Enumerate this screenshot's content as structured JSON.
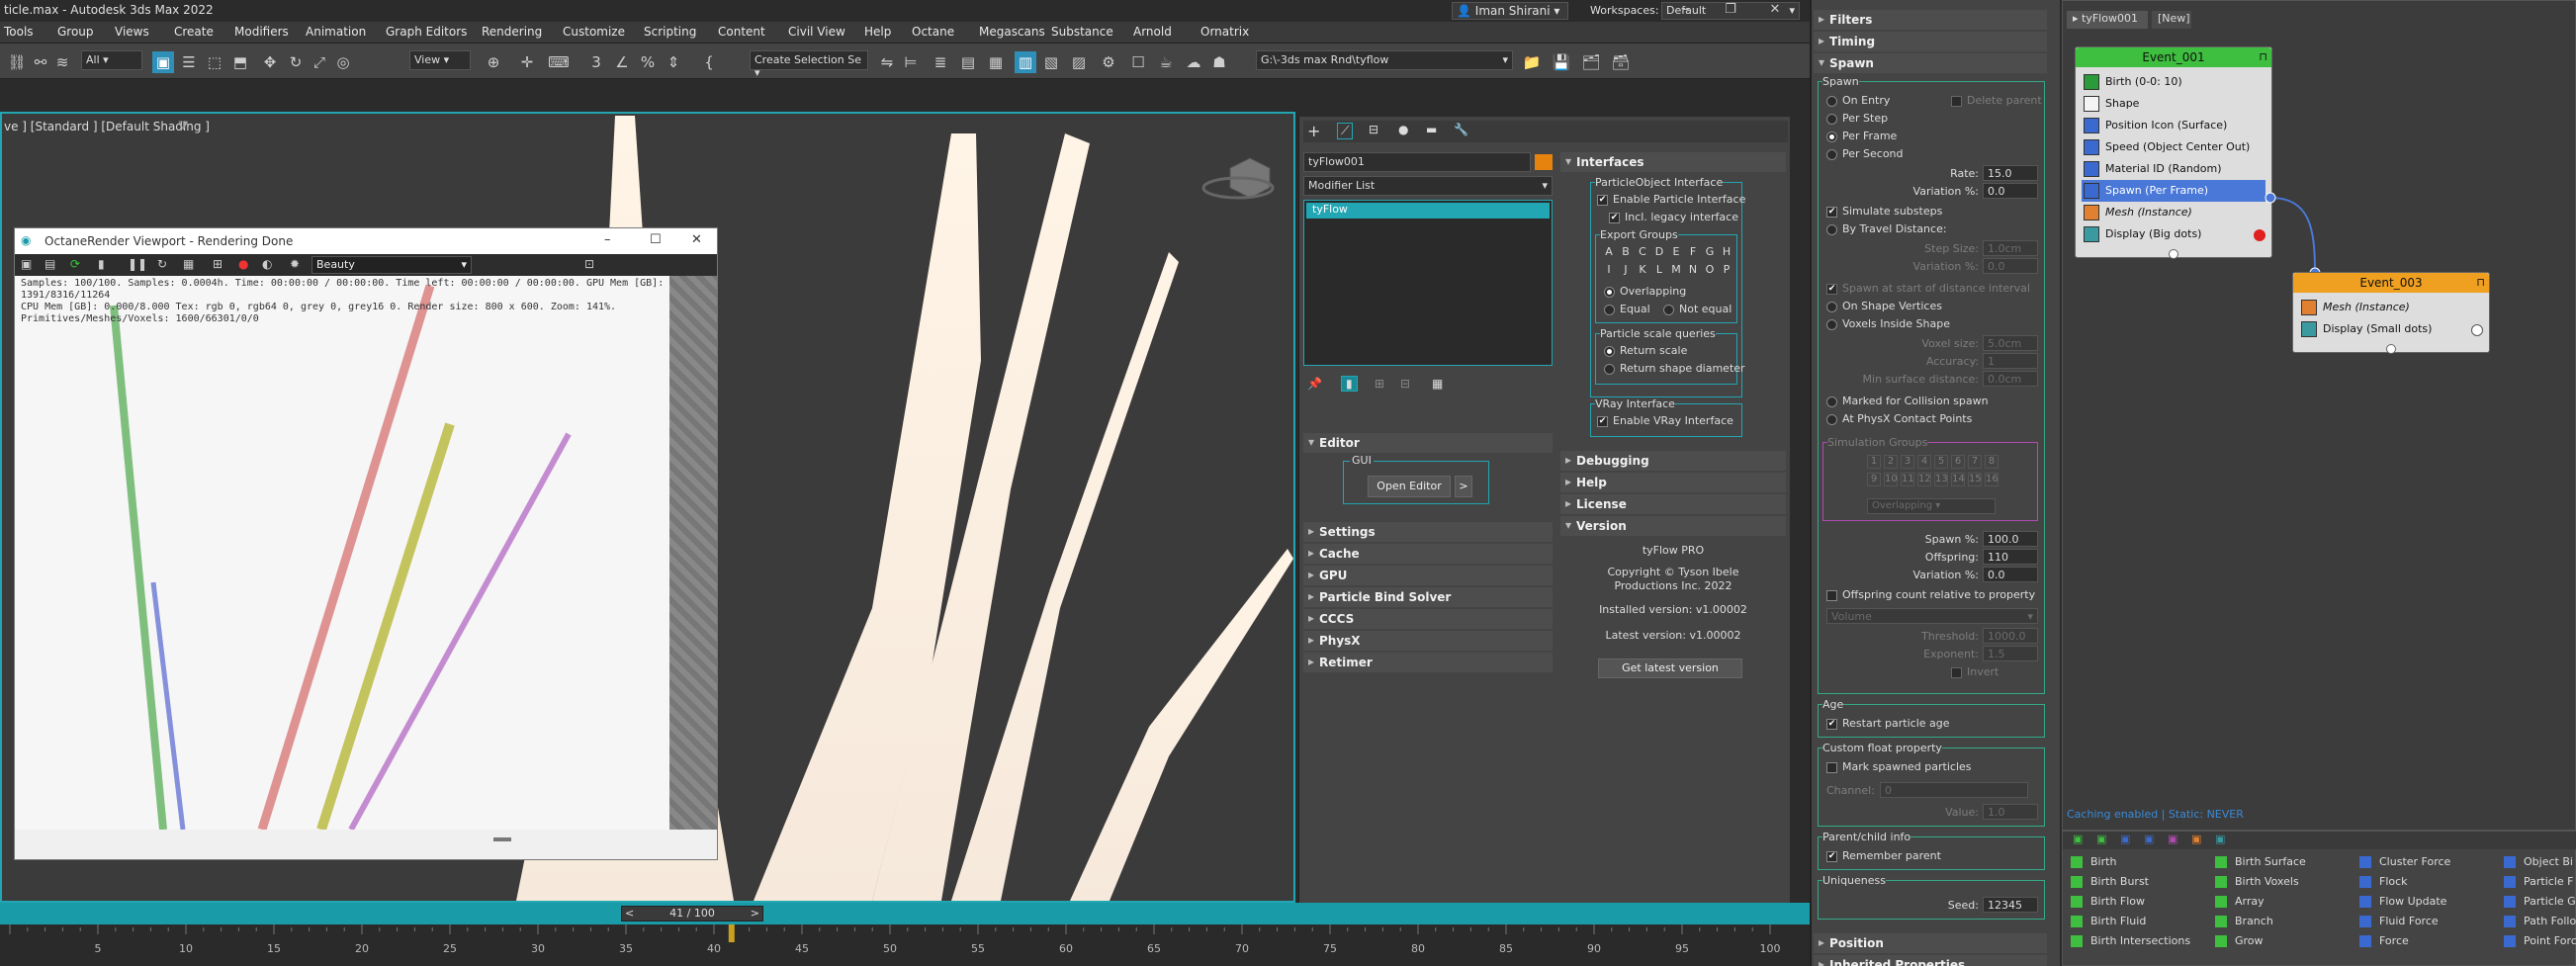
{
  "app": {
    "title": "ticle.max - Autodesk 3ds Max 2022",
    "user": "Iman Shirani",
    "workspaces_label": "Workspaces:",
    "workspace": "Default"
  },
  "menu": [
    "Tools",
    "Group",
    "Views",
    "Create",
    "Modifiers",
    "Animation",
    "Graph Editors",
    "Rendering",
    "Customize",
    "Scripting",
    "Content",
    "Civil View",
    "Help",
    "Octane",
    "Megascans",
    "Substance",
    "Arnold",
    "Ornatrix"
  ],
  "toolbar": {
    "selection_filter": "All",
    "ref_coord": "View",
    "named_selection": "Create Selection Se",
    "project_path": "G:\\-3ds max Rnd\\tyflow"
  },
  "viewport": {
    "label": "ve ] [Standard ] [Default Shading ]"
  },
  "octane": {
    "title": "OctaneRender Viewport - Rendering Done",
    "pass": "Beauty",
    "info": [
      "Samples: 100/100.  Samples: 0.0004h.  Time: 00:00:00 / 00:00:00.  Time left: 00:00:00 / 00:00:00.  GPU Mem [GB]: 1391/8316/11264",
      "CPU Mem [GB]: 0.000/8.000  Tex: rgb 0, rgb64 0, grey 0, grey16 0.  Render size: 800 x 600.  Zoom: 141%.",
      "Primitives/Meshes/Voxels: 1600/66301/0/0"
    ]
  },
  "command_panel": {
    "object_name": "tyFlow001",
    "modifier_list": "Modifier List",
    "stack_item": "tyFlow",
    "rollouts": [
      "Editor",
      "Settings",
      "Cache",
      "GPU",
      "Particle Bind Solver",
      "CCCS",
      "PhysX",
      "Retimer"
    ],
    "editor": {
      "group": "GUI",
      "open_button": "Open Editor",
      "more_button": ">"
    },
    "interfaces": {
      "title": "Interfaces",
      "particle_object": "ParticleObject Interface",
      "enable_particle": "Enable Particle Interface",
      "legacy": "Incl. legacy interface",
      "export_groups": "Export Groups",
      "letters": [
        "A",
        "B",
        "C",
        "D",
        "E",
        "F",
        "G",
        "H",
        "I",
        "J",
        "K",
        "L",
        "M",
        "N",
        "O",
        "P"
      ],
      "overlapping": "Overlapping",
      "equal": "Equal",
      "not_equal": "Not equal",
      "scale_queries": "Particle scale queries",
      "return_scale": "Return scale",
      "return_shape": "Return shape diameter",
      "vray": "VRay Interface",
      "enable_vray": "Enable VRay Interface"
    },
    "right_rollouts": [
      "Debugging",
      "Help",
      "License"
    ],
    "version": {
      "title": "Version",
      "product": "tyFlow PRO",
      "copyright": "Copyright © Tyson Ibele Productions Inc. 2022",
      "installed": "Installed version: v1.00002",
      "latest": "Latest version: v1.00002",
      "get_button": "Get latest version"
    }
  },
  "flow_panel": {
    "filters": "Filters",
    "timing": "Timing",
    "spawn": "Spawn",
    "spawn_group": "Spawn",
    "on_entry": "On Entry",
    "delete_parent": "Delete parent",
    "per_step": "Per Step",
    "per_frame": "Per Frame",
    "per_second": "Per Second",
    "rate_label": "Rate:",
    "rate": "15.0",
    "variation_label": "Variation %:",
    "variation": "0.0",
    "simulate_substeps": "Simulate substeps",
    "by_travel": "By Travel Distance:",
    "step_size_label": "Step Size:",
    "step_size": "1.0cm",
    "variation2": "0.0",
    "spawn_start": "Spawn at start of distance interval",
    "on_shape_vertices": "On Shape Vertices",
    "voxels_inside": "Voxels Inside Shape",
    "voxel_size_label": "Voxel size:",
    "voxel_size": "5.0cm",
    "accuracy_label": "Accuracy:",
    "accuracy": "1",
    "min_surface_label": "Min surface distance:",
    "min_surface": "0.0cm",
    "marked_collision": "Marked for Collision spawn",
    "physx_contact": "At PhysX Contact Points",
    "sim_groups": "Simulation Groups",
    "group_numbers": [
      "1",
      "2",
      "3",
      "4",
      "5",
      "6",
      "7",
      "8",
      "9",
      "10",
      "11",
      "12",
      "13",
      "14",
      "15",
      "16"
    ],
    "overlapping": "Overlapping",
    "spawn_pct_label": "Spawn %:",
    "spawn_pct": "100.0",
    "offspring_label": "Offspring:",
    "offspring": "110",
    "variation3_label": "Variation %:",
    "variation3": "0.0",
    "offspring_relative": "Offspring count relative to property",
    "volume": "Volume",
    "threshold_label": "Threshold:",
    "threshold": "1000.0",
    "exponent_label": "Exponent:",
    "exponent": "1.5",
    "invert": "Invert",
    "age_group": "Age",
    "restart_age": "Restart particle age",
    "custom_float": "Custom float property",
    "mark_spawned": "Mark spawned particles",
    "channel_label": "Channel:",
    "channel": "0",
    "value_label": "Value:",
    "value": "1.0",
    "parent_child": "Parent/child info",
    "remember_parent": "Remember parent",
    "uniqueness": "Uniqueness",
    "seed_label": "Seed:",
    "seed": "12345",
    "position": "Position",
    "inherited": "Inherited Properties"
  },
  "graph": {
    "tab": "tyFlow001",
    "tab2": "[New]",
    "event1": {
      "title": "Event_001",
      "ops": [
        "Birth (0-0: 10)",
        "Shape",
        "Position Icon (Surface)",
        "Speed (Object Center Out)",
        "Material ID (Random)",
        "Spawn (Per Frame)",
        "Mesh (Instance)",
        "Display (Big dots)"
      ]
    },
    "event3": {
      "title": "Event_003",
      "ops": [
        "Mesh (Instance)",
        "Display (Small dots)"
      ]
    },
    "status": "Caching enabled | Static: NEVER"
  },
  "palette": [
    [
      "Birth",
      "Birth Burst",
      "Birth Flow",
      "Birth Fluid",
      "Birth Intersections"
    ],
    [
      "Birth Surface",
      "Birth Voxels",
      "Array",
      "Branch",
      "Grow"
    ],
    [
      "Cluster Force",
      "Flock",
      "Flow Update",
      "Fluid Force",
      "Force"
    ],
    [
      "Object Bi",
      "Particle F",
      "Particle G",
      "Path Follo",
      "Point Forc"
    ]
  ],
  "timeline": {
    "frame": "41 / 100",
    "ticks": [
      "5",
      "10",
      "15",
      "20",
      "25",
      "30",
      "35",
      "40",
      "45",
      "50",
      "55",
      "60",
      "65",
      "70",
      "75",
      "80",
      "85",
      "90",
      "95",
      "100"
    ],
    "current": 41
  },
  "colors": {
    "accent": "#22a6b3",
    "event_green": "#3fbf3f",
    "event_orange": "#f0a020",
    "spawn_blue": "#4a78d8"
  }
}
